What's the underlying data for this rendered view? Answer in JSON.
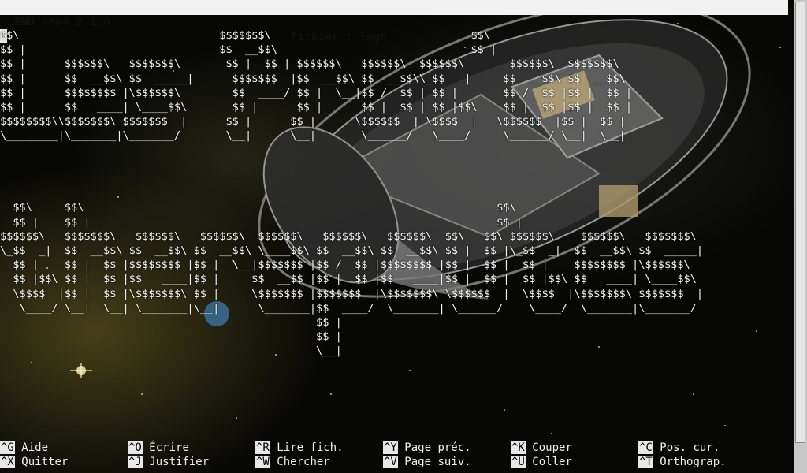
{
  "titlebar": {
    "app": "GNU nano 2.2.6",
    "file": "Fichier : logo"
  },
  "editor": {
    "lines": [
      "$$\\                               $$$$$$$\\                               $$\\",
      "$$ |                              $$  __$$\\                              $$ |",
      "$$ |      $$$$$$\\   $$$$$$$\\       $$ |  $$ | $$$$$$\\   $$$$$$\\  $$$$$$\\       $$$$$$\\  $$$$$$$\\",
      "$$ |      $$  __$$\\ $$  _____|      $$$$$$$  |$$  __$$\\ $$  __$$\\\\_$$  _|     $$  __$$\\ $$  __$$\\",
      "$$ |      $$$$$$$$ |\\$$$$$$\\        $$  ____/ $$ |  \\__|$$ /  $$ | $$ |       $$ /  $$ |$$ |  $$ |",
      "$$ |      $$   ____| \\____$$\\       $$ |      $$ |      $$ |  $$ | $$ |$$\\    $$ |  $$ |$$ |  $$ |",
      "$$$$$$$$\\\\$$$$$$$\\ $$$$$$$  |      $$ |      $$ |      \\$$$$$$  | \\$$$$  |   \\$$$$$$  |$$ |  $$ |",
      "\\________|\\_______|\\_______/       \\__|      \\__|       \\______/   \\____/     \\______/ \\__|  \\__|",
      "",
      "",
      "",
      "",
      "  $$\\     $$\\                                                                $$\\",
      "  $$ |    $$ |                                                               $$ |",
      "$$$$$$\\   $$$$$$$\\   $$$$$$\\   $$$$$$\\  $$$$$$\\   $$$$$$\\   $$$$$$\\  $$\\   $$\\ $$$$$$\\    $$$$$$\\   $$$$$$$\\",
      "\\_$$  _|  $$  __$$\\ $$  __$$\\ $$  __$$\\ \\____$$\\ $$  __$$\\ $$  __$$\\ $$ |  $$ |\\_$$  _|  $$  __$$\\ $$  _____|",
      "  $$ |    $$ |  $$ |$$$$$$$$ |$$ |  \\__|$$$$$$$ |$$ /  $$ |$$$$$$$$ |$$ |  $$ |  $$ |    $$$$$$$$ |\\$$$$$$\\",
      "  $$ |$$\\ $$ |  $$ |$$   ____|$$ |     $$  __$$ |$$ |  $$ |$$   ____|$$ |  $$ |  $$ |$$\\ $$   ____| \\____$$\\",
      "  \\$$$$  |$$ |  $$ |\\$$$$$$$\\ $$ |     \\$$$$$$$ |$$$$$$$  |\\$$$$$$$\\ \\$$$$$$  |  \\$$$$  |\\$$$$$$$\\ $$$$$$$  |",
      "   \\____/ \\__|  \\__| \\_______|\\__|      \\_______|$$  ____/  \\_______| \\______/    \\____/  \\_______|\\_______/",
      "                                                 $$ |",
      "                                                 $$ |",
      "                                                 \\__|"
    ]
  },
  "shortcuts": [
    {
      "key": "^G",
      "label": "Aide"
    },
    {
      "key": "^X",
      "label": "Quitter"
    },
    {
      "key": "^O",
      "label": "Écrire"
    },
    {
      "key": "^J",
      "label": "Justifier"
    },
    {
      "key": "^R",
      "label": "Lire fich."
    },
    {
      "key": "^W",
      "label": "Chercher"
    },
    {
      "key": "^Y",
      "label": "Page préc."
    },
    {
      "key": "^V",
      "label": "Page suiv."
    },
    {
      "key": "^K",
      "label": "Couper"
    },
    {
      "key": "^U",
      "label": "Coller"
    },
    {
      "key": "^C",
      "label": "Pos. cur."
    },
    {
      "key": "^T",
      "label": "Orthograp."
    }
  ],
  "colors": {
    "titlebar_bg": "#f2f2f2",
    "text": "#f3f3f3",
    "key_bg": "#e8e8e8"
  }
}
